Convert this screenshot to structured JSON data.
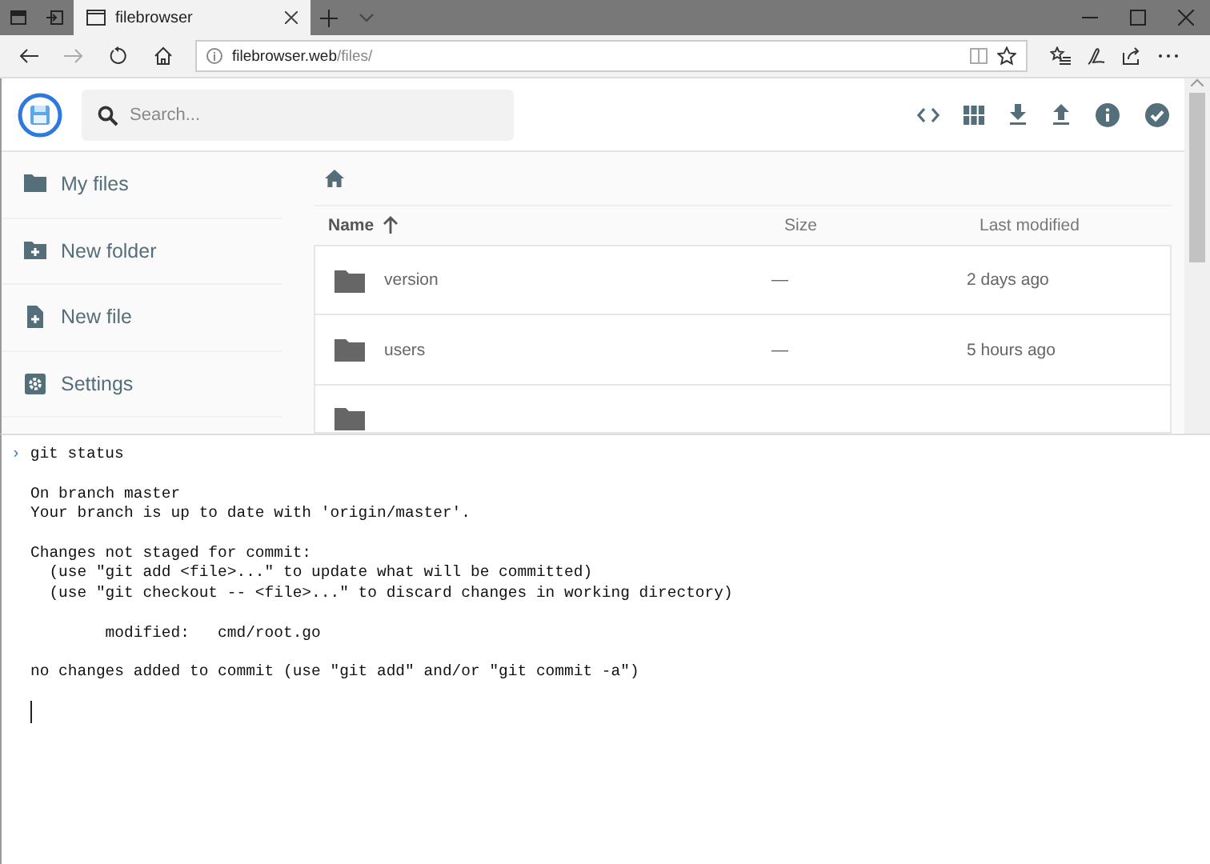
{
  "browser": {
    "tabs": [
      {
        "title": "filebrowser",
        "selected": true
      }
    ],
    "address": {
      "host": "filebrowser.web",
      "path": "/files/"
    }
  },
  "app": {
    "search": {
      "placeholder": "Search..."
    },
    "sidebar": {
      "items": [
        {
          "label": "My files"
        },
        {
          "label": "New folder"
        },
        {
          "label": "New file"
        },
        {
          "label": "Settings"
        }
      ]
    },
    "table": {
      "columns": [
        {
          "label": "Name",
          "sorted": true
        },
        {
          "label": "Size",
          "sorted": false
        },
        {
          "label": "Last modified",
          "sorted": false
        }
      ],
      "rows": [
        {
          "name": "version",
          "size": "—",
          "modified": "2 days ago"
        },
        {
          "name": "users",
          "size": "—",
          "modified": "5 hours ago"
        }
      ]
    }
  },
  "terminal": {
    "prompt": "›",
    "command": "git status",
    "output": [
      [
        "On branch master",
        "Your branch is up to date with 'origin/master'."
      ],
      [
        "Changes not staged for commit:",
        "  (use \"git add <file>...\" to update what will be committed)",
        "  (use \"git checkout -- <file>...\" to discard changes in working directory)"
      ],
      [
        "        modified:   cmd/root.go"
      ],
      [
        "no changes added to commit (use \"git add\" and/or \"git commit -a\")"
      ]
    ]
  }
}
